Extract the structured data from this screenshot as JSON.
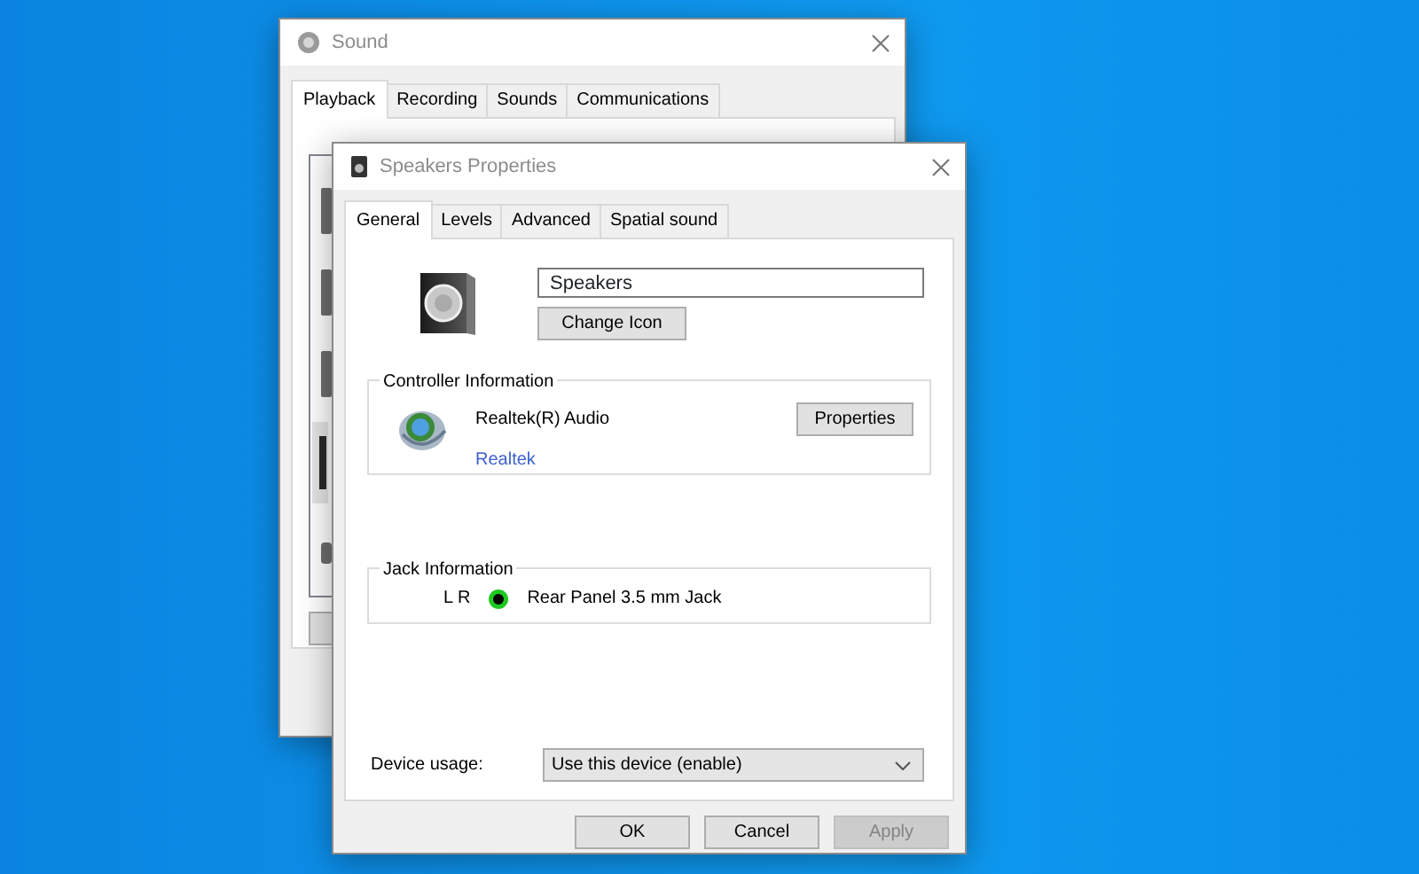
{
  "sound_window": {
    "title": "Sound",
    "tabs": [
      {
        "label": "Playback",
        "selected": true
      },
      {
        "label": "Recording",
        "selected": false
      },
      {
        "label": "Sounds",
        "selected": false
      },
      {
        "label": "Communications",
        "selected": false
      }
    ]
  },
  "properties_window": {
    "title": "Speakers Properties",
    "tabs": [
      {
        "label": "General",
        "selected": true
      },
      {
        "label": "Levels",
        "selected": false
      },
      {
        "label": "Advanced",
        "selected": false
      },
      {
        "label": "Spatial sound",
        "selected": false
      }
    ],
    "device_name": "Speakers",
    "change_icon_button": "Change Icon",
    "controller": {
      "heading": "Controller Information",
      "name": "Realtek(R) Audio",
      "link": "Realtek",
      "button": "Properties"
    },
    "jack": {
      "heading": "Jack Information",
      "jacks": [
        {
          "channels": "L R",
          "color": "#1ec81e",
          "label": "Rear Panel 3.5 mm Jack"
        }
      ]
    },
    "device_usage": {
      "label": "Device usage:",
      "value": "Use this device (enable)"
    },
    "buttons": [
      {
        "label": "OK",
        "disabled": false
      },
      {
        "label": "Cancel",
        "disabled": false
      },
      {
        "label": "Apply",
        "disabled": true
      }
    ]
  }
}
